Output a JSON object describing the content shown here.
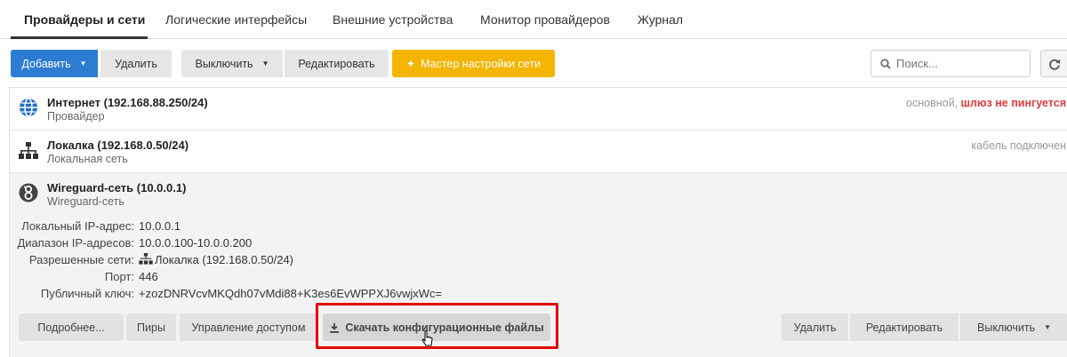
{
  "tabs": [
    {
      "label": "Провайдеры и сети"
    },
    {
      "label": "Логические интерфейсы"
    },
    {
      "label": "Внешние устройства"
    },
    {
      "label": "Монитор провайдеров"
    },
    {
      "label": "Журнал"
    }
  ],
  "toolbar": {
    "add": "Добавить",
    "delete": "Удалить",
    "disable": "Выключить",
    "edit": "Редактировать",
    "wizard": "Мастер настройки сети",
    "search_placeholder": "Поиск..."
  },
  "rows": [
    {
      "title": "Интернет (192.168.88.250/24)",
      "sub": "Провайдер",
      "status_prefix": "основной, ",
      "status_alert": "шлюз не пингуется"
    },
    {
      "title": "Локалка (192.168.0.50/24)",
      "sub": "Локальная сеть",
      "status": "кабель подключен"
    }
  ],
  "wireguard": {
    "title": "Wireguard-сеть (10.0.0.1)",
    "sub": "Wireguard-сеть",
    "fields": [
      {
        "label": "Локальный IP-адрес:",
        "value": "10.0.0.1"
      },
      {
        "label": "Диапазон IP-адресов:",
        "value": "10.0.0.100-10.0.0.200"
      },
      {
        "label": "Разрешенные сети:",
        "value": "Локалка (192.168.0.50/24)"
      },
      {
        "label": "Порт:",
        "value": "446"
      },
      {
        "label": "Публичный ключ:",
        "value": "+zozDNRVcvMKQdh07vMdi88+K3es6EvWPPXJ6vwjxWc="
      }
    ],
    "actions": {
      "details": "Подробнее...",
      "peers": "Пиры",
      "access": "Управление доступом",
      "download": "Скачать конфигурационные файлы",
      "delete": "Удалить",
      "edit": "Редактировать",
      "disable": "Выключить"
    }
  },
  "colors": {
    "primary": "#2c7cd1",
    "warn": "#f5b400",
    "alert": "#e03b3b",
    "highlight": "#e10000"
  }
}
